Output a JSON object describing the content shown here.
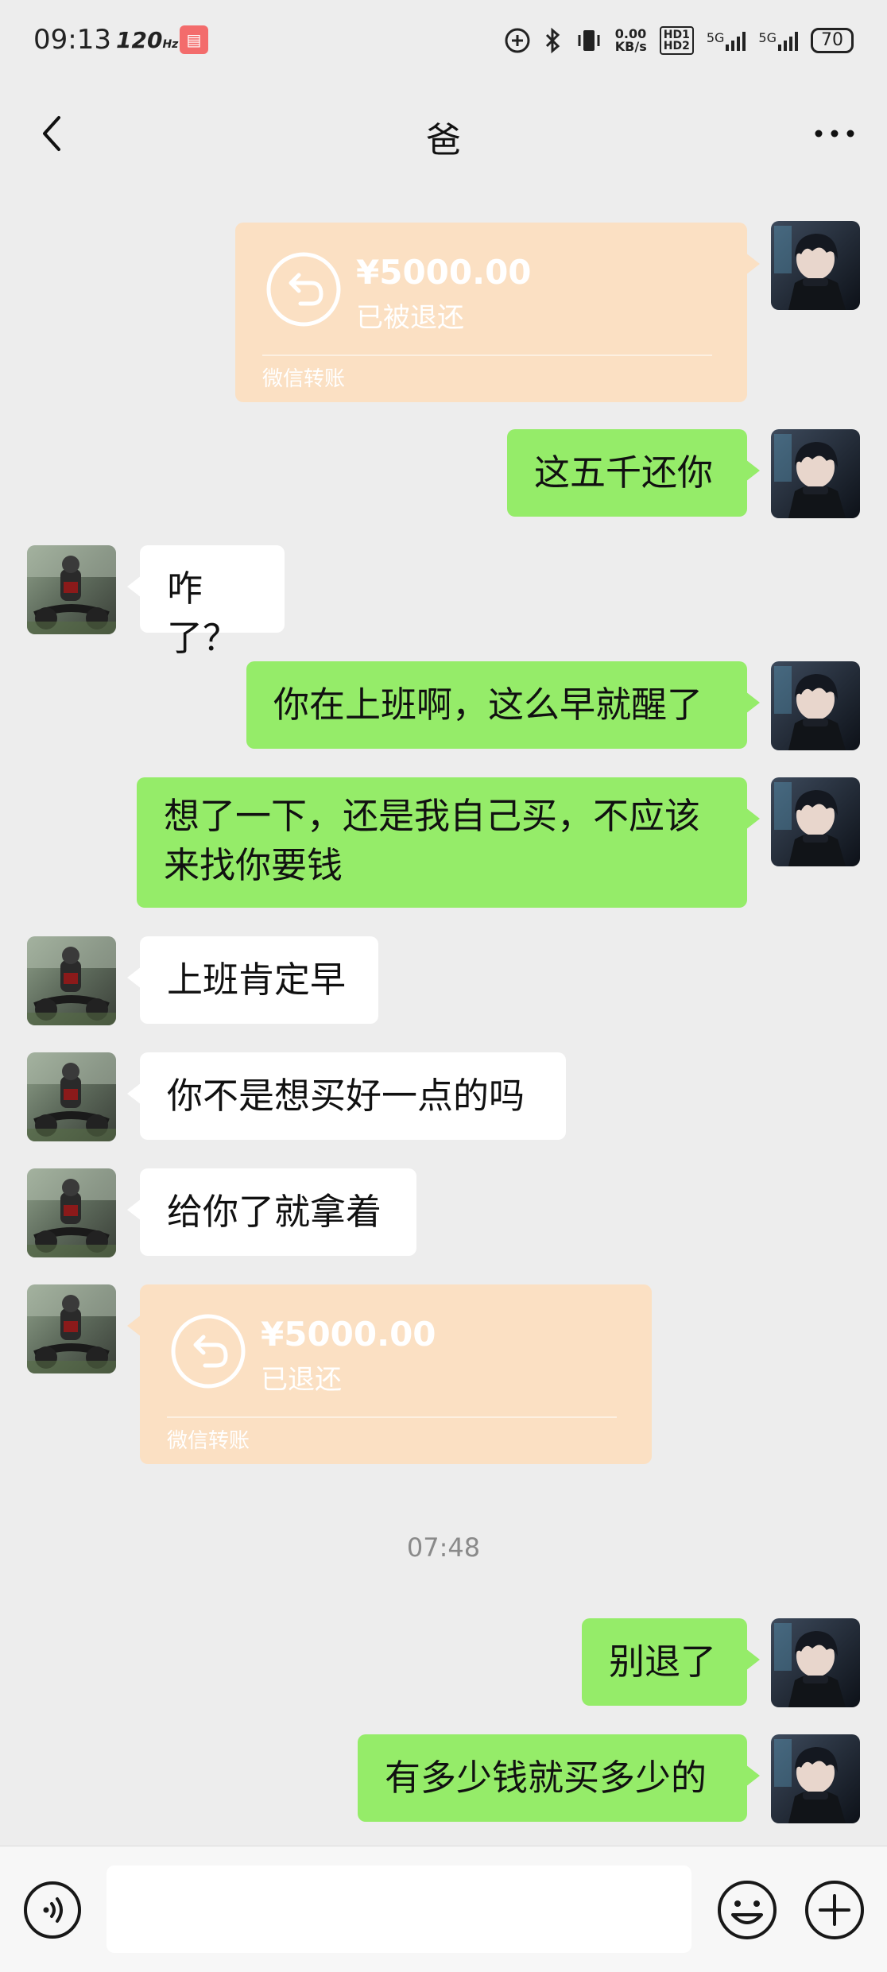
{
  "status_bar": {
    "time": "09:13",
    "refresh": "120",
    "refresh_unit": "Hz",
    "net_speed_value": "0.00",
    "net_speed_unit": "KB/s",
    "hd1": "HD1",
    "hd2": "HD2",
    "sim1": "5G",
    "sim2": "5G",
    "battery": "70"
  },
  "header": {
    "title": "爸"
  },
  "messages": [
    {
      "type": "transfer",
      "side": "right",
      "amount": "¥5000.00",
      "status": "已被退还",
      "label": "微信转账"
    },
    {
      "type": "text",
      "side": "right",
      "text": "这五千还你"
    },
    {
      "type": "text",
      "side": "left",
      "text": "咋了？"
    },
    {
      "type": "text",
      "side": "right",
      "text": "你在上班啊，这么早就醒了"
    },
    {
      "type": "text",
      "side": "right",
      "text_line1": "想了一下，还是我自己买，不应该",
      "text_line2": "来找你要钱"
    },
    {
      "type": "text",
      "side": "left",
      "text": "上班肯定早"
    },
    {
      "type": "text",
      "side": "left",
      "text": "你不是想买好一点的吗"
    },
    {
      "type": "text",
      "side": "left",
      "text": "给你了就拿着"
    },
    {
      "type": "transfer",
      "side": "left",
      "amount": "¥5000.00",
      "status": "已退还",
      "label": "微信转账"
    },
    {
      "type": "text",
      "side": "right",
      "text": "别退了"
    },
    {
      "type": "text",
      "side": "right",
      "text": "有多少钱就买多少的"
    }
  ],
  "timestamp": "07:48",
  "input": {
    "value": "",
    "placeholder": ""
  },
  "colors": {
    "background": "#ededed",
    "bubble_self": "#95ec69",
    "bubble_other": "#ffffff",
    "transfer": "#fbe0c3"
  }
}
